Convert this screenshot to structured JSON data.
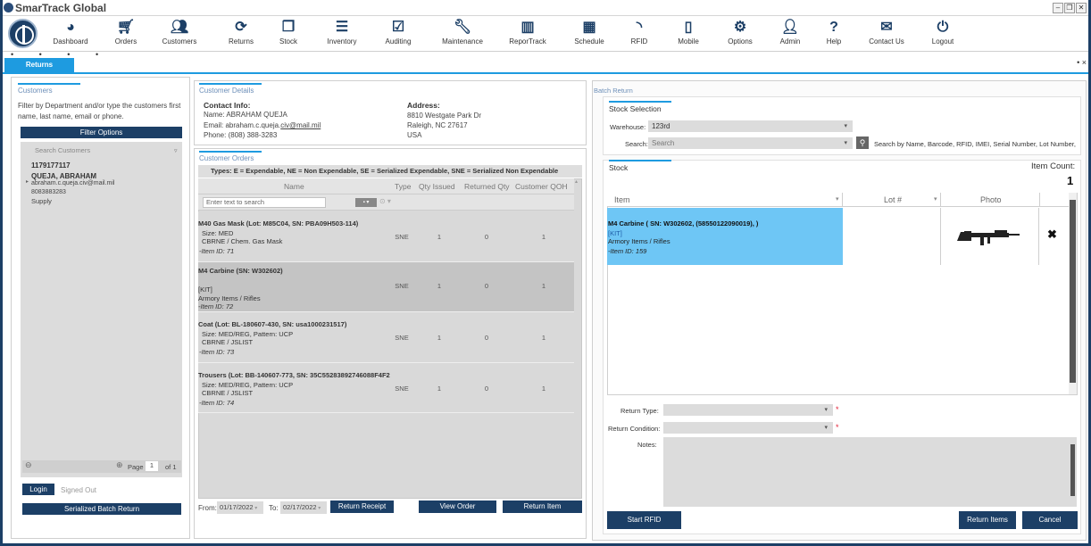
{
  "app": {
    "title": "SmarTrack Global",
    "window_controls": [
      "–",
      "❐",
      "✕"
    ]
  },
  "toolbar": {
    "items": [
      {
        "label": "Dashboard",
        "icon": "dashboard-icon"
      },
      {
        "label": "Orders",
        "icon": "cart-icon"
      },
      {
        "label": "Customers",
        "icon": "users-icon"
      },
      {
        "label": "Returns",
        "icon": "refresh-icon"
      },
      {
        "label": "Stock",
        "icon": "copy-icon"
      },
      {
        "label": "Inventory",
        "icon": "list-icon"
      },
      {
        "label": "Auditing",
        "icon": "calendar-check-icon"
      },
      {
        "label": "Maintenance",
        "icon": "wrench-icon"
      },
      {
        "label": "ReporTrack",
        "icon": "bar-chart-icon"
      },
      {
        "label": "Schedule",
        "icon": "calendar-icon"
      },
      {
        "label": "RFID",
        "icon": "rss-icon"
      },
      {
        "label": "Mobile",
        "icon": "mobile-icon"
      },
      {
        "label": "Options",
        "icon": "cogs-icon"
      },
      {
        "label": "Admin",
        "icon": "user-icon"
      },
      {
        "label": "Help",
        "icon": "help-icon"
      },
      {
        "label": "Contact Us",
        "icon": "envelope-icon"
      },
      {
        "label": "Logout",
        "icon": "power-icon"
      }
    ]
  },
  "tabs": {
    "active": "Returns",
    "dots": "• • • •",
    "extra": "• ×"
  },
  "customers": {
    "title": "Customers",
    "help": "Filter by Department and/or type the customers first name, last name, email or phone.",
    "filter_button": "Filter Options",
    "search_placeholder": "Search Customers",
    "entry": {
      "id": "1179177117",
      "name": "QUEJA, ABRAHAM",
      "email": "abraham.c.queja.civ@mail.mil",
      "phone": "8083883283",
      "dept": "Supply"
    },
    "pager": {
      "page_label": "Page",
      "page": "1",
      "of": "of 1"
    },
    "login_button": "Login",
    "status": "Signed Out",
    "batch_button": "Serialized Batch Return"
  },
  "customer_details": {
    "title": "Customer Details",
    "contact_heading": "Contact Info:",
    "name": "Name: ABRAHAM QUEJA",
    "email_prefix": "Email: abraham.c.queja.",
    "email_link": "civ@mail.mil",
    "phone": "Phone: (808) 388-3283",
    "address_heading": "Address:",
    "address_line1": "8810 Westgate Park Dr",
    "address_line2": "Raleigh, NC 27617",
    "address_line3": "USA"
  },
  "customer_orders": {
    "title": "Customer Orders",
    "types_legend": "Types:   E = Expendable, NE = Non Expendable, SE = Serialized Expendable, SNE = Serialized Non Expendable",
    "columns": [
      "Name",
      "Type",
      "Qty Issued",
      "Returned Qty",
      "Customer QOH"
    ],
    "filter_placeholder": "Enter text to search",
    "rows": [
      {
        "title": "M40 Gas Mask (Lot: M85C04, SN: PBA09H503-114)",
        "line1": "Size: MED",
        "line2": "CBRNE / Chem. Gas Mask",
        "item_id": "-Item ID: 71",
        "type": "SNE",
        "issued": "1",
        "returned": "0",
        "qoh": "1"
      },
      {
        "title": "M4 Carbine (SN: W302602)",
        "line1": "",
        "line2": "[KIT]",
        "line3": "Armory Items / Rifles",
        "item_id": "-Item ID: 72",
        "type": "SNE",
        "issued": "1",
        "returned": "0",
        "qoh": "1"
      },
      {
        "title": "Coat (Lot: BL-180607-430, SN: usa1000231517)",
        "line1": "Size: MED/REG, Pattern: UCP",
        "line2": "CBRNE / JSLIST",
        "item_id": "-Item ID: 73",
        "type": "SNE",
        "issued": "1",
        "returned": "0",
        "qoh": "1"
      },
      {
        "title": "Trousers (Lot: BB-140607-773, SN: 35C55283892746088F4F2",
        "line1": "Size: MED/REG, Pattern: UCP",
        "line2": "CBRNE / JSLIST",
        "item_id": "-Item ID: 74",
        "type": "SNE",
        "issued": "1",
        "returned": "0",
        "qoh": "1"
      }
    ],
    "from_label": "From:",
    "from_date": "01/17/2022",
    "to_label": "To:",
    "to_date": "02/17/2022",
    "receipt_button": "Return Receipt",
    "view_button": "View Order",
    "return_item_button": "Return Item"
  },
  "batch_return": {
    "title": "Batch Return",
    "stock_selection": "Stock Selection",
    "warehouse_label": "Warehouse:",
    "warehouse_value": "123rd",
    "search_label": "Search:",
    "search_placeholder": "Search",
    "search_hint": "Search by Name, Barcode, RFID, IMEI, Serial Number, Lot Number,",
    "stock_title": "Stock",
    "item_count_label": "Item Count:",
    "item_count": "1",
    "columns": [
      "Item",
      "Lot #",
      "Photo"
    ],
    "item": {
      "title": "M4 Carbine ( SN: W302602, (58550122090019), )",
      "kit": "[KIT]",
      "category": "Armory Items / Rifles",
      "item_id": "-Item ID: 159"
    },
    "return_type_label": "Return Type:",
    "return_condition_label": "Return Condition:",
    "notes_label": "Notes:",
    "required_mark": "*",
    "start_rfid_button": "Start RFID",
    "return_items_button": "Return Items",
    "cancel_button": "Cancel"
  },
  "colors": {
    "navy": "#1c3f66",
    "accent": "#1e9be0",
    "selected_row": "#6ec6f5"
  }
}
